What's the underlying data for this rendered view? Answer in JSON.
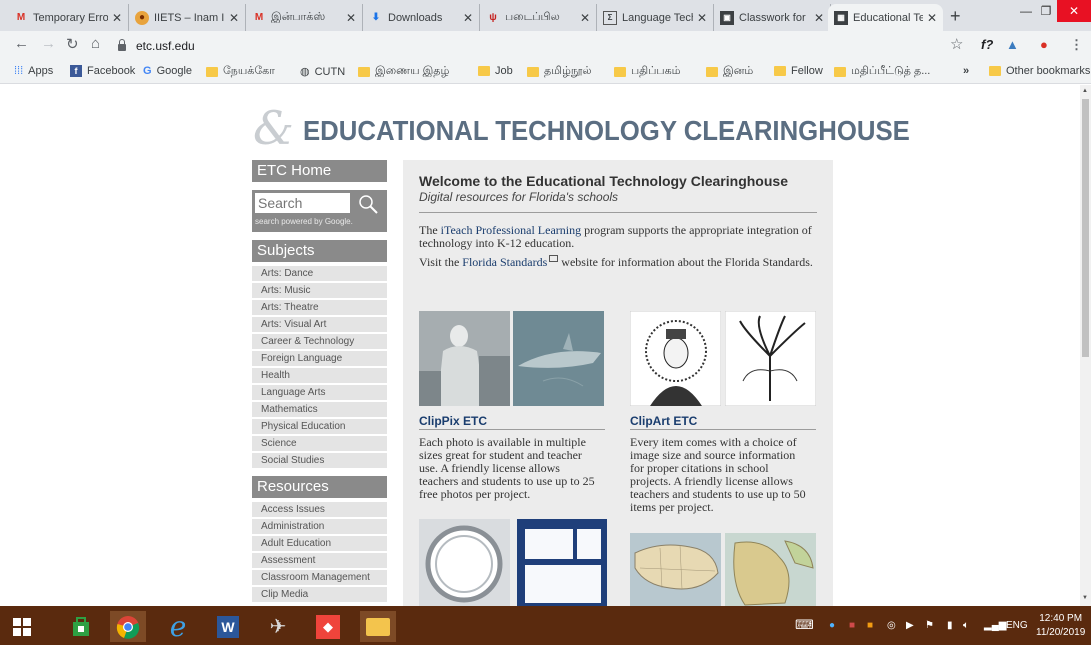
{
  "browser": {
    "tabs": [
      {
        "label": "Temporary Erro",
        "icon": "gmail-icon"
      },
      {
        "label": "IIETS – Inam Int",
        "icon": "site-icon"
      },
      {
        "label": "இன்பாக்ஸ்",
        "icon": "gmail-icon"
      },
      {
        "label": "Downloads",
        "icon": "download-icon"
      },
      {
        "label": "படைப்பில",
        "icon": "site-icon"
      },
      {
        "label": "Language Tech",
        "icon": "site-icon"
      },
      {
        "label": "Classwork for",
        "icon": "classroom-icon"
      },
      {
        "label": "Educational Tec",
        "icon": "etc-icon"
      }
    ],
    "new_tab": "+",
    "url": "etc.usf.edu",
    "bookmarks": [
      {
        "label": "Apps",
        "type": "apps"
      },
      {
        "label": "Facebook",
        "type": "facebook"
      },
      {
        "label": "Google",
        "type": "google"
      },
      {
        "label": "நேயக்கோ",
        "type": "folder"
      },
      {
        "label": "CUTN",
        "type": "site"
      },
      {
        "label": "இணைய இதழ்",
        "type": "folder"
      },
      {
        "label": "Job",
        "type": "folder"
      },
      {
        "label": "தமிழ்நூல்",
        "type": "folder"
      },
      {
        "label": "பதிப்பகம்",
        "type": "folder"
      },
      {
        "label": "இனம்",
        "type": "folder"
      },
      {
        "label": "Fellow",
        "type": "folder"
      },
      {
        "label": "மதிப்பீட்டுத் த...",
        "type": "folder"
      }
    ],
    "bookmarks_more": "»",
    "other_bookmarks": "Other bookmarks"
  },
  "page": {
    "logo_text": "EDUCATIONAL TECHNOLOGY CLEARINGHOUSE",
    "sidebar": {
      "home": "ETC Home",
      "search_placeholder": "Search",
      "search_note": "search powered by Google.",
      "subjects_head": "Subjects",
      "subjects": [
        "Arts: Dance",
        "Arts: Music",
        "Arts: Theatre",
        "Arts: Visual Art",
        "Career & Technology",
        "Foreign Language",
        "Health",
        "Language Arts",
        "Mathematics",
        "Physical Education",
        "Science",
        "Social Studies"
      ],
      "resources_head": "Resources",
      "resources": [
        "Access Issues",
        "Administration",
        "Adult Education",
        "Assessment",
        "Classroom Management",
        "Clip Media"
      ]
    },
    "main": {
      "title": "Welcome to the Educational Technology Clearinghouse",
      "subtitle": "Digital resources for Florida's schools",
      "p1_pre": "The ",
      "p1_link": "iTeach Professional Learning",
      "p1_post": " program supports the appropriate integration of technology into K-12 education.",
      "p2_pre": "Visit the ",
      "p2_link": "Florida Standards",
      "p2_post": " website for information about the Florida Standards.",
      "cards": [
        {
          "title": "ClipPix ETC",
          "text": "Each photo is available in multiple sizes great for student and teacher use. A friendly license allows teachers and students to use up to 25 free photos per project."
        },
        {
          "title": "ClipArt ETC",
          "text": "Every item comes with a choice of image size and source information for proper citations in school projects. A friendly license allows teachers and students to use up to 50 items per project."
        }
      ]
    }
  },
  "taskbar": {
    "language": "ENG",
    "time": "12:40 PM",
    "date": "11/20/2019"
  }
}
